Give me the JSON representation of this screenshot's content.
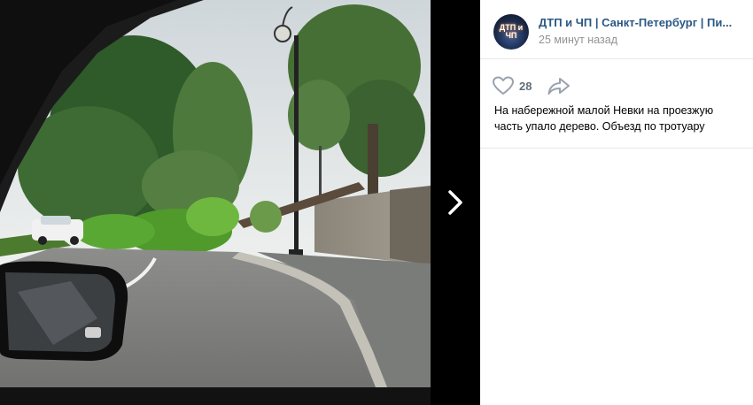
{
  "post": {
    "group_name": "ДТП и ЧП | Санкт-Петербург | Пи...",
    "time": "25 минут назад",
    "likes": "28",
    "text": "На набережной малой Невки на проезжую часть упало дерево. Объезд по тротуару",
    "avatar_text": "ДТП и ЧП"
  },
  "icons": {
    "like": "heart-icon",
    "share": "share-arrow-icon",
    "next": "chevron-right-icon"
  },
  "colors": {
    "link": "#2a5885",
    "meta": "#939393",
    "counter": "#626d7a",
    "viewer_bg": "#000000"
  }
}
